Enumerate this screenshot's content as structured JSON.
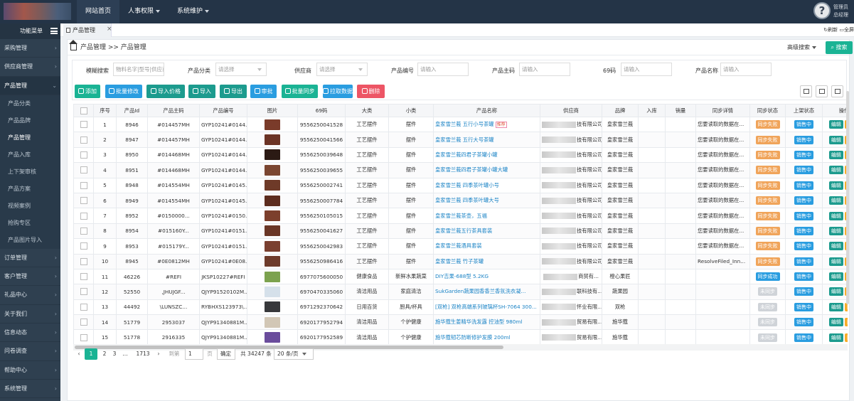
{
  "topnav": [
    "网站首页",
    "人事权限",
    "系统维护"
  ],
  "user": {
    "line1": "管理员",
    "line2": "总经理"
  },
  "sidebar": {
    "title": "功能菜单",
    "menus_before": [
      "采购管理",
      "供应商管理"
    ],
    "open_menu": "产品管理",
    "sub_items": [
      "产品分类",
      "产品品牌",
      "产品管理",
      "产品入库",
      "上下架审核",
      "产品方案",
      "视频案例",
      "抢购专区",
      "产品图片导入"
    ],
    "active_sub": "产品管理",
    "menus_after": [
      "订单管理",
      "客户管理",
      "礼品中心",
      "关于我们",
      "信息动态",
      "问卷调查",
      "帮助中心",
      "系统管理"
    ]
  },
  "tab": {
    "label": "产品管理",
    "close": "×",
    "right_refresh": "刷新",
    "right_full": "全屏"
  },
  "breadcrumb": "产品管理 >> 产品管理",
  "advanced_search": "高级搜索",
  "search_button": "搜索",
  "filters": [
    {
      "label": "模糊搜索",
      "placeholder": "物料名字|型号|供应商"
    },
    {
      "label": "产品分类",
      "placeholder": "请选择"
    },
    {
      "label": "供应商",
      "placeholder": "请选择"
    },
    {
      "label": "产品编号",
      "placeholder": "请输入"
    },
    {
      "label": "产品主码",
      "placeholder": "请输入"
    },
    {
      "label": "69码",
      "placeholder": "请输入"
    },
    {
      "label": "产品名称",
      "placeholder": "请输入"
    }
  ],
  "toolbar": [
    "添加",
    "批量修改",
    "导入价格",
    "导入",
    "导出",
    "审批",
    "批量同步",
    "拉取数据",
    "删除"
  ],
  "toolbar_colors": [
    "#1ab394",
    "#2a9de0",
    "#1c9b8e",
    "#1c9b8e",
    "#1c9b8e",
    "#2a9de0",
    "#1ab394",
    "#2a9de0",
    "#ed5565"
  ],
  "columns": [
    "",
    "序号",
    "产品Id",
    "产品主码",
    "产品编号",
    "图片",
    "69码",
    "大类",
    "小类",
    "产品名称",
    "供应商",
    "品牌",
    "入库",
    "销量",
    "同步详情",
    "同步状态",
    "上架状态",
    "操作"
  ],
  "rows": [
    {
      "no": "1",
      "id": "8946",
      "main": "#014457MH",
      "code": "GYP10241#0144...",
      "ean": "9556250041528",
      "cat": "工艺摆件",
      "sub": "摆件",
      "name": "皇家雪兰莪 五行小号茶罐",
      "tag": "推荐",
      "supplier": "技有限公司",
      "brand": "皇家雪兰莪",
      "detail": "您要读取的数据在...",
      "sync": "同步失败",
      "shelf": "销售中"
    },
    {
      "no": "2",
      "id": "8947",
      "main": "#014457MH",
      "code": "GYP10241#0144...",
      "ean": "9556250041566",
      "cat": "工艺摆件",
      "sub": "摆件",
      "name": "皇家雪兰莪 五行大号茶罐",
      "tag": "",
      "supplier": "技有限公司",
      "brand": "皇家雪兰莪",
      "detail": "您要读取的数据在...",
      "sync": "同步失败",
      "shelf": "销售中"
    },
    {
      "no": "3",
      "id": "8950",
      "main": "#014468MH",
      "code": "GYP10241#0144...",
      "ean": "9556250039648",
      "cat": "工艺摆件",
      "sub": "摆件",
      "name": "皇家雪兰莪四君子茶罐小罐",
      "tag": "",
      "supplier": "技有限公司",
      "brand": "皇家雪兰莪",
      "detail": "您要读取的数据在...",
      "sync": "同步失败",
      "shelf": "销售中"
    },
    {
      "no": "4",
      "id": "8951",
      "main": "#014468MH",
      "code": "GYP10241#0144...",
      "ean": "9556250039655",
      "cat": "工艺摆件",
      "sub": "摆件",
      "name": "皇家雪兰莪四君子茶罐小罐大罐",
      "tag": "",
      "supplier": "技有限公司",
      "brand": "皇家雪兰莪",
      "detail": "您要读取的数据在...",
      "sync": "同步失败",
      "shelf": "销售中"
    },
    {
      "no": "5",
      "id": "8948",
      "main": "#014554MH",
      "code": "GYP10241#0145...",
      "ean": "9556250002741",
      "cat": "工艺摆件",
      "sub": "摆件",
      "name": "皇家雪兰莪 四季茶叶罐小号",
      "tag": "",
      "supplier": "技有限公司",
      "brand": "皇家雪兰莪",
      "detail": "您要读取的数据在...",
      "sync": "同步失败",
      "shelf": "销售中"
    },
    {
      "no": "6",
      "id": "8949",
      "main": "#014554MH",
      "code": "GYP10241#0145...",
      "ean": "9556250007784",
      "cat": "工艺摆件",
      "sub": "摆件",
      "name": "皇家雪兰莪 四季茶叶罐大号",
      "tag": "",
      "supplier": "技有限公司",
      "brand": "皇家雪兰莪",
      "detail": "您要读取的数据在...",
      "sync": "同步失败",
      "shelf": "销售中"
    },
    {
      "no": "7",
      "id": "8952",
      "main": "#0150000...",
      "code": "GYP10241#0150...",
      "ean": "9556250105015",
      "cat": "工艺摆件",
      "sub": "摆件",
      "name": "皇家雪兰莪茶壶，五福",
      "tag": "",
      "supplier": "技有限公司",
      "brand": "皇家雪兰莪",
      "detail": "您要读取的数据在...",
      "sync": "同步失败",
      "shelf": "销售中"
    },
    {
      "no": "8",
      "id": "8954",
      "main": "#015160Y...",
      "code": "GYP10241#0151...",
      "ean": "9556250041627",
      "cat": "工艺摆件",
      "sub": "摆件",
      "name": "皇家雪兰莪五行茶具套装",
      "tag": "",
      "supplier": "技有限公司",
      "brand": "皇家雪兰莪",
      "detail": "您要读取的数据在...",
      "sync": "同步失败",
      "shelf": "销售中"
    },
    {
      "no": "9",
      "id": "8953",
      "main": "#015179Y...",
      "code": "GYP10241#0151...",
      "ean": "9556250042983",
      "cat": "工艺摆件",
      "sub": "摆件",
      "name": "皇家雪兰莪酒具套装",
      "tag": "",
      "supplier": "技有限公司",
      "brand": "皇家雪兰莪",
      "detail": "您要读取的数据在...",
      "sync": "同步失败",
      "shelf": "销售中"
    },
    {
      "no": "10",
      "id": "8945",
      "main": "#0E0812MH",
      "code": "GYP10241#0E08...",
      "ean": "9556250986416",
      "cat": "工艺摆件",
      "sub": "摆件",
      "name": "皇家雪兰莪 竹子茶罐",
      "tag": "",
      "supplier": "技有限公司",
      "brand": "皇家雪兰莪",
      "detail": "ResolveFiled_Inn...",
      "sync": "同步失败",
      "shelf": "销售中"
    },
    {
      "no": "11",
      "id": "46226",
      "main": "#REFI",
      "code": "JKSP10227#REFI",
      "ean": "6977075600050",
      "cat": "健康食品",
      "sub": "新鲜水果蔬菜",
      "name": "DIY吉果-688型 5.2KG",
      "tag": "",
      "supplier": "商贸有...",
      "brand": "橙心果匠",
      "detail": "",
      "sync": "同步成功",
      "shelf": "销售中"
    },
    {
      "no": "12",
      "id": "52550",
      "main": ",JHUJGF...",
      "code": "QJYP91520102M...",
      "ean": "6970470335060",
      "cat": "清洁用品",
      "sub": "家庭清洁",
      "name": "SukGarden蔬果园香香兰香氛洗衣凝...",
      "tag": "",
      "supplier": "联科技有...",
      "brand": "蔬果园",
      "detail": "",
      "sync": "未同步",
      "shelf": "销售中"
    },
    {
      "no": "13",
      "id": "44492",
      "main": "\\LUNSZC...",
      "code": "RYBHXS123973\\...",
      "ean": "6971292370642",
      "cat": "日用百货",
      "sub": "厨具/杯具",
      "name": "[双枪] 双枪高端系列玻璃杯SH-7064 300...",
      "tag": "",
      "supplier": "怀业有限...",
      "brand": "双枪",
      "detail": "",
      "sync": "未同步",
      "shelf": "销售中"
    },
    {
      "no": "14",
      "id": "51779",
      "main": "2953037",
      "code": "QJYP91340881M...",
      "ean": "6920177952794",
      "cat": "清洁用品",
      "sub": "个护健康",
      "name": "施华蔻生姜精华洗发露 控油型 980ml",
      "tag": "",
      "supplier": "贸易有限...",
      "brand": "施华蔻",
      "detail": "",
      "sync": "未同步",
      "shelf": "销售中"
    },
    {
      "no": "15",
      "id": "51778",
      "main": "2916335",
      "code": "QJYP91340881M...",
      "ean": "6920177952589",
      "cat": "清洁用品",
      "sub": "个护健康",
      "name": "施华蔻韧芯防断修护发膜 200ml",
      "tag": "",
      "supplier": "贸易有限...",
      "brand": "施华蔻",
      "detail": "",
      "sync": "未同步",
      "shelf": "销售中"
    }
  ],
  "actions": {
    "edit": "编辑",
    "sync": "同步"
  },
  "pager": {
    "pages": [
      "1",
      "2",
      "3",
      "...",
      "1713"
    ],
    "goto": "到第",
    "page_value": "1",
    "page_unit": "页",
    "confirm": "确定",
    "total": "共 34247 条",
    "per_page": "20 条/页"
  }
}
